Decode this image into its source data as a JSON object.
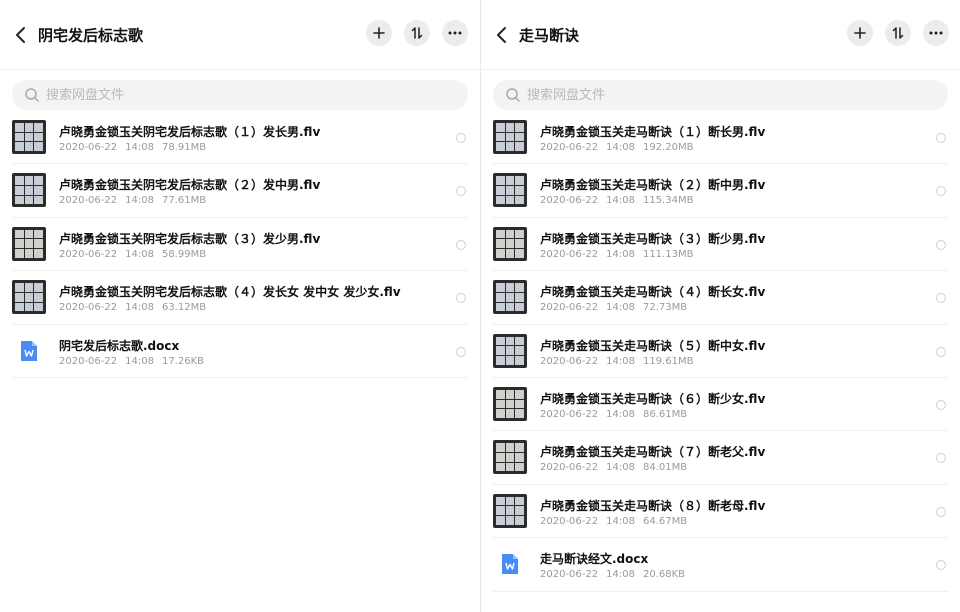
{
  "left_panel": {
    "title": "阴宅发后标志歌",
    "search_placeholder": "搜索网盘文件",
    "files": [
      {
        "name": "卢晓勇金锁玉关阴宅发后标志歌（１）发长男.flv",
        "date": "2020-06-22",
        "time": "14:08",
        "size": "78.91MB",
        "type": "video"
      },
      {
        "name": "卢晓勇金锁玉关阴宅发后标志歌（２）发中男.flv",
        "date": "2020-06-22",
        "time": "14:08",
        "size": "77.61MB",
        "type": "video"
      },
      {
        "name": "卢晓勇金锁玉关阴宅发后标志歌（３）发少男.flv",
        "date": "2020-06-22",
        "time": "14:08",
        "size": "58.99MB",
        "type": "video"
      },
      {
        "name": "卢晓勇金锁玉关阴宅发后标志歌（４）发长女 发中女 发少女.flv",
        "date": "2020-06-22",
        "time": "14:08",
        "size": "63.12MB",
        "type": "video"
      },
      {
        "name": "阴宅发后标志歌.docx",
        "date": "2020-06-22",
        "time": "14:08",
        "size": "17.26KB",
        "type": "doc"
      }
    ]
  },
  "right_panel": {
    "title": "走马断诀",
    "search_placeholder": "搜索网盘文件",
    "files": [
      {
        "name": "卢晓勇金锁玉关走马断诀（１）断长男.flv",
        "date": "2020-06-22",
        "time": "14:08",
        "size": "192.20MB",
        "type": "video"
      },
      {
        "name": "卢晓勇金锁玉关走马断诀（２）断中男.flv",
        "date": "2020-06-22",
        "time": "14:08",
        "size": "115.34MB",
        "type": "video"
      },
      {
        "name": "卢晓勇金锁玉关走马断诀（３）断少男.flv",
        "date": "2020-06-22",
        "time": "14:08",
        "size": "111.13MB",
        "type": "video"
      },
      {
        "name": "卢晓勇金锁玉关走马断诀（４）断长女.flv",
        "date": "2020-06-22",
        "time": "14:08",
        "size": "72.73MB",
        "type": "video"
      },
      {
        "name": "卢晓勇金锁玉关走马断诀（５）断中女.flv",
        "date": "2020-06-22",
        "time": "14:08",
        "size": "119.61MB",
        "type": "video"
      },
      {
        "name": "卢晓勇金锁玉关走马断诀（６）断少女.flv",
        "date": "2020-06-22",
        "time": "14:08",
        "size": "86.61MB",
        "type": "video"
      },
      {
        "name": "卢晓勇金锁玉关走马断诀（７）断老父.flv",
        "date": "2020-06-22",
        "time": "14:08",
        "size": "84.01MB",
        "type": "video"
      },
      {
        "name": "卢晓勇金锁玉关走马断诀（８）断老母.flv",
        "date": "2020-06-22",
        "time": "14:08",
        "size": "64.67MB",
        "type": "video"
      },
      {
        "name": "走马断诀经文.docx",
        "date": "2020-06-22",
        "time": "14:08",
        "size": "20.68KB",
        "type": "doc"
      }
    ]
  },
  "icons": {
    "back": "chevron-left-icon",
    "add": "plus-icon",
    "sort": "sort-icon",
    "more": "more-icon",
    "search": "search-icon",
    "doc": "word-doc-icon"
  },
  "colors": {
    "doc_blue": "#4a8cf7",
    "button_bg": "#ececec",
    "search_bg": "#f3f3f3",
    "meta_text": "#9a9a9a"
  }
}
